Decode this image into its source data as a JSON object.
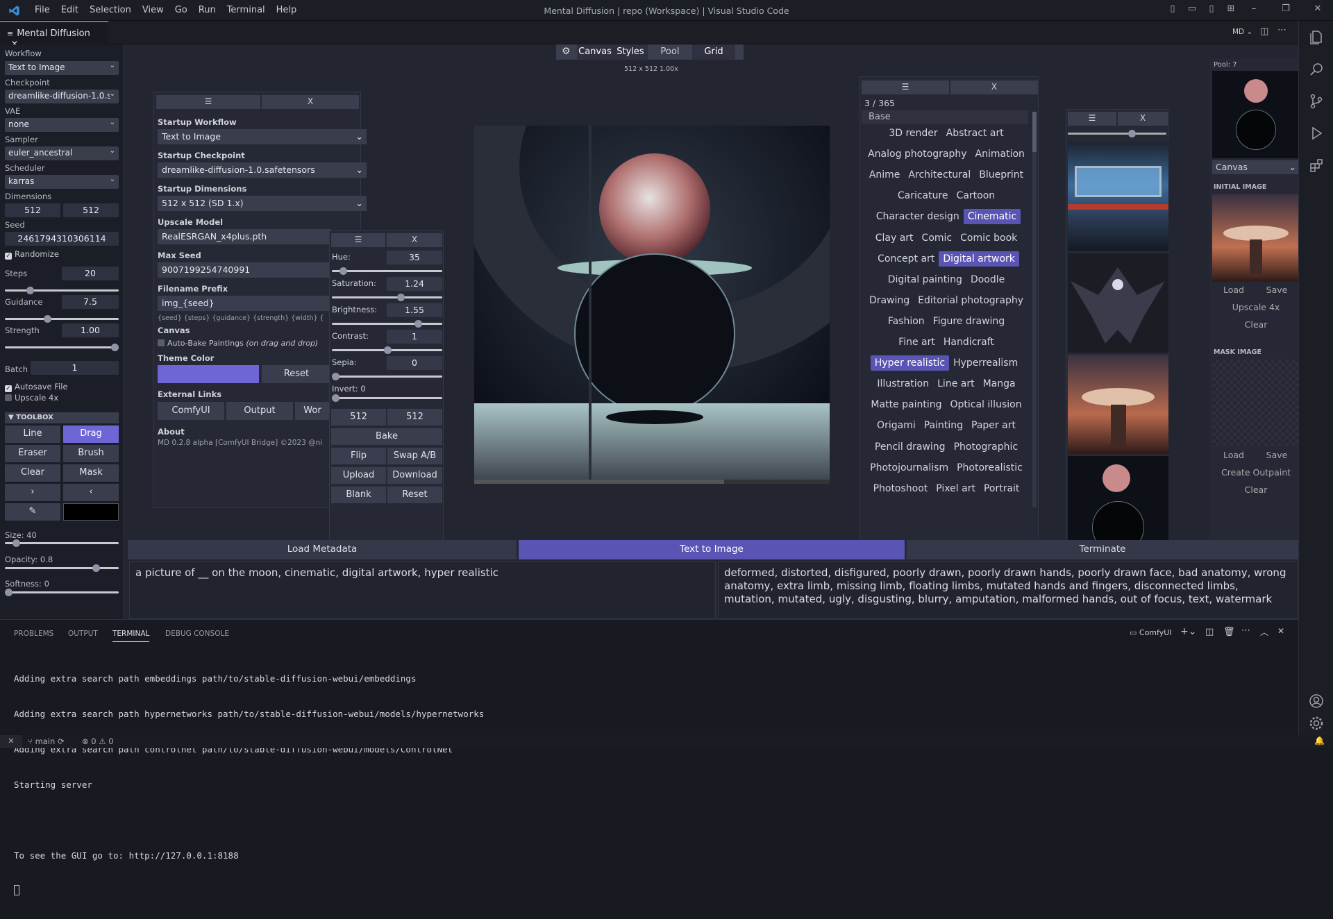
{
  "titlebar": {
    "menu": [
      "File",
      "Edit",
      "Selection",
      "View",
      "Go",
      "Run",
      "Terminal",
      "Help"
    ],
    "title": "Mental Diffusion | repo (Workspace) | Visual Studio Code"
  },
  "tab": {
    "label": "Mental Diffusion",
    "close": "✕",
    "icon": "≡"
  },
  "editor_actions": {
    "md": "MD"
  },
  "sidebar": {
    "workflow_label": "Workflow",
    "workflow": "Text to Image",
    "checkpoint_label": "Checkpoint",
    "checkpoint": "dreamlike-diffusion-1.0.s",
    "vae_label": "VAE",
    "vae": "none",
    "sampler_label": "Sampler",
    "sampler": "euler_ancestral",
    "scheduler_label": "Scheduler",
    "scheduler": "karras",
    "dimensions_label": "Dimensions",
    "width": "512",
    "height": "512",
    "seed_label": "Seed",
    "seed": "2461794310306114",
    "randomize": "Randomize",
    "steps_label": "Steps",
    "steps": "20",
    "steps_frac": 0.22,
    "guidance_label": "Guidance",
    "guidance": "7.5",
    "guidance_frac": 0.37,
    "strength_label": "Strength",
    "strength": "1.00",
    "strength_frac": 1.0,
    "batch_label": "Batch",
    "batch": "1",
    "autosave": "Autosave File",
    "upscale": "Upscale 4x",
    "toolbox": "TOOLBOX",
    "tools": [
      "Line",
      "Drag",
      "Eraser",
      "Brush",
      "Clear",
      "Mask",
      "›",
      "‹"
    ],
    "size_label": "Size: 40",
    "size_frac": 0.1,
    "opacity_label": "Opacity: 0.8",
    "opacity_frac": 0.8,
    "softness_label": "Softness: 0",
    "softness_frac": 0.0
  },
  "topbar": {
    "tabs": [
      "Canvas",
      "Styles",
      "Pool",
      "Grid"
    ],
    "info": "512 x 512  1.00x"
  },
  "settings": {
    "menu": "☰",
    "close": "X",
    "startup_workflow_label": "Startup Workflow",
    "startup_workflow": "Text to Image",
    "startup_checkpoint_label": "Startup Checkpoint",
    "startup_checkpoint": "dreamlike-diffusion-1.0.safetensors",
    "startup_dimensions_label": "Startup Dimensions",
    "startup_dimensions": "512 x 512 (SD 1.x)",
    "upscale_model_label": "Upscale Model",
    "upscale_model": "RealESRGAN_x4plus.pth",
    "max_seed_label": "Max Seed",
    "max_seed": "9007199254740991",
    "filename_prefix_label": "Filename Prefix",
    "filename_prefix": "img_{seed}",
    "prefix_hint": "{seed} {steps} {guidance} {strength} {width} {",
    "canvas_label": "Canvas",
    "auto_bake": "Auto-Bake Paintings",
    "auto_bake_note": "(on drag and drop)",
    "theme_color_label": "Theme Color",
    "theme_color": "#6f66d6",
    "reset": "Reset",
    "external_links_label": "External Links",
    "links": [
      "ComfyUI",
      "Output",
      "Wor"
    ],
    "about_label": "About",
    "about": "MD 0.2.8 alpha [ComfyUI Bridge] ©2023 @ni"
  },
  "adjust": {
    "menu": "☰",
    "close": "X",
    "hue_label": "Hue:",
    "hue": "35",
    "hue_frac": 0.1,
    "saturation_label": "Saturation:",
    "saturation": "1.24",
    "saturation_frac": 0.62,
    "brightness_label": "Brightness:",
    "brightness": "1.55",
    "brightness_frac": 0.78,
    "contrast_label": "Contrast:",
    "contrast": "1",
    "contrast_frac": 0.5,
    "sepia_label": "Sepia:",
    "sepia": "0",
    "sepia_frac": 0.0,
    "invert_label": "Invert: 0",
    "invert_frac": 0.0,
    "w": "512",
    "h": "512",
    "buttons": [
      "Bake",
      "Flip",
      "Swap A/B",
      "Upload",
      "Download",
      "Blank",
      "Reset"
    ]
  },
  "styles": {
    "menu": "☰",
    "close": "X",
    "count": "3 / 365",
    "group": "Base",
    "rows": [
      [
        "3D render",
        "Abstract art"
      ],
      [
        "Analog photography",
        "Animation"
      ],
      [
        "Anime",
        "Architectural",
        "Blueprint"
      ],
      [
        "Caricature",
        "Cartoon"
      ],
      [
        "Character design",
        "Cinematic"
      ],
      [
        "Clay art",
        "Comic",
        "Comic book"
      ],
      [
        "Concept art",
        "Digital artwork"
      ],
      [
        "Digital painting",
        "Doodle"
      ],
      [
        "Drawing",
        "Editorial photography"
      ],
      [
        "Fashion",
        "Figure drawing"
      ],
      [
        "Fine art",
        "Handicraft"
      ],
      [
        "Hyper realistic",
        "Hyperrealism"
      ],
      [
        "Illustration",
        "Line art",
        "Manga"
      ],
      [
        "Matte painting",
        "Optical illusion"
      ],
      [
        "Origami",
        "Painting",
        "Paper art"
      ],
      [
        "Pencil drawing",
        "Photographic"
      ],
      [
        "Photojournalism",
        "Photorealistic"
      ],
      [
        "Photoshoot",
        "Pixel art",
        "Portrait"
      ]
    ],
    "selected": [
      "Cinematic",
      "Digital artwork",
      "Hyper realistic"
    ]
  },
  "gallery": {
    "menu": "☰",
    "close": "X",
    "zoom_frac": 0.65
  },
  "pool": {
    "label": "Pool: 7",
    "mode": "Canvas",
    "initial_label": "INITIAL IMAGE",
    "load": "Load",
    "save": "Save",
    "upscale": "Upscale 4x",
    "clear": "Clear",
    "mask_label": "MASK IMAGE",
    "mask_load": "Load",
    "mask_save": "Save",
    "outpaint": "Create Outpaint",
    "mask_clear": "Clear"
  },
  "actions": {
    "load_metadata": "Load Metadata",
    "generate": "Text to Image",
    "terminate": "Terminate"
  },
  "prompts": {
    "positive": "a picture of __ on the moon, cinematic, digital artwork, hyper realistic",
    "negative": "deformed, distorted, disfigured, poorly drawn, poorly drawn hands, poorly drawn face, bad anatomy, wrong anatomy, extra limb, missing limb, floating limbs, mutated hands and fingers, disconnected limbs, mutation, mutated, ugly, disgusting, blurry, amputation, malformed hands, out of focus, text, watermark"
  },
  "panel": {
    "tabs": [
      "PROBLEMS",
      "OUTPUT",
      "TERMINAL",
      "DEBUG CONSOLE"
    ],
    "terminal_name": "ComfyUI",
    "lines": [
      "Adding extra search path embeddings path/to/stable-diffusion-webui/embeddings",
      "Adding extra search path hypernetworks path/to/stable-diffusion-webui/models/hypernetworks",
      "Adding extra search path controlnet path/to/stable-diffusion-webui/models/ControlNet",
      "Starting server",
      "",
      "To see the GUI go to: http://127.0.0.1:8188"
    ]
  },
  "status": {
    "branch": "main",
    "errors": "0",
    "warnings": "0"
  },
  "colors": {
    "accent": "#6c6ad0",
    "selected_style": "#5a55b4",
    "theme": "#6f66d6"
  }
}
